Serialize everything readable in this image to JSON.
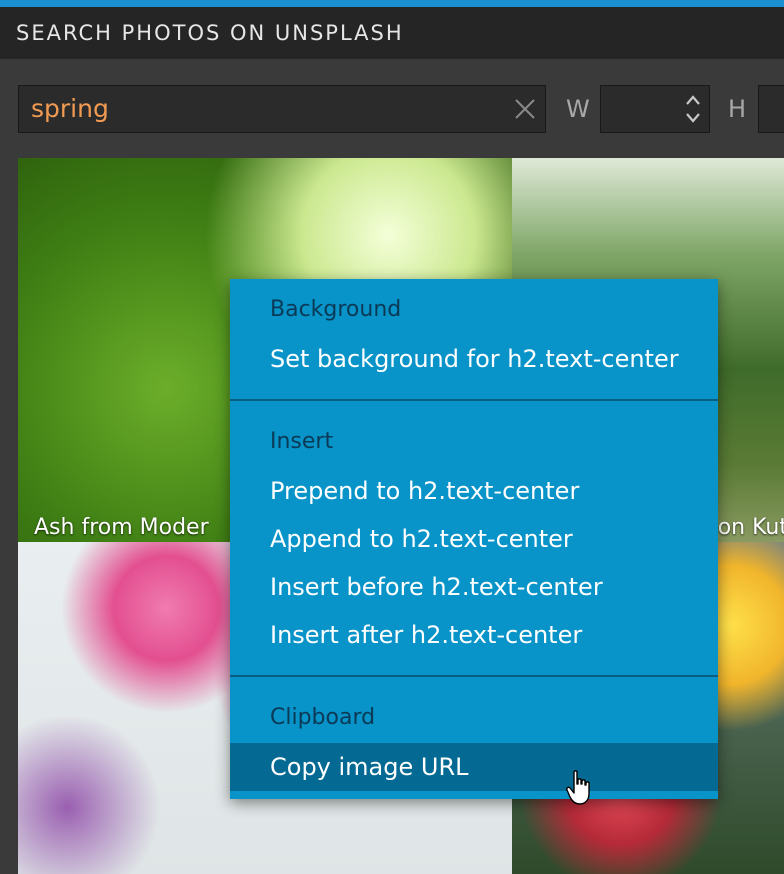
{
  "panel_title": "SEARCH PHOTOS ON UNSPLASH",
  "search": {
    "value": "spring",
    "clear_icon": "close-icon"
  },
  "dimensions": {
    "w_label": "W",
    "h_label": "H"
  },
  "photos": [
    {
      "caption": "Ash from Moder"
    },
    {
      "caption": "on Kut"
    },
    {
      "caption": ""
    },
    {
      "caption": ""
    }
  ],
  "context_menu": {
    "sections": [
      {
        "header": "Background",
        "items": [
          "Set background for h2.text-center"
        ]
      },
      {
        "header": "Insert",
        "items": [
          "Prepend to h2.text-center",
          "Append to h2.text-center",
          "Insert before h2.text-center",
          "Insert after h2.text-center"
        ]
      },
      {
        "header": "Clipboard",
        "items": [
          "Copy image URL"
        ]
      }
    ],
    "highlighted_item": "Copy image URL"
  },
  "colors": {
    "accent": "#1a8fd1",
    "menu_bg": "#0893c9",
    "menu_highlight": "#056a93",
    "search_text": "#f19a52"
  }
}
